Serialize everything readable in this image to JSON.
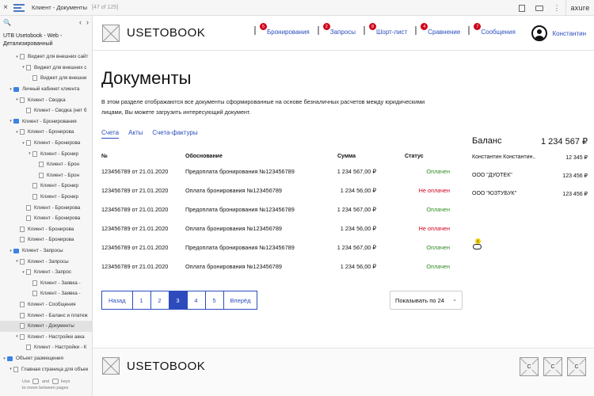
{
  "topbar": {
    "close": "×",
    "title": "Клиент - Документы",
    "count": "[47 of 125]",
    "logo": "axure"
  },
  "sidebar": {
    "search": "🔍",
    "prev": "‹",
    "next": "›",
    "project": "UTB Usetobook - Web - Детализированный",
    "items": [
      {
        "label": "Виджет для внешних сайт",
        "indent": 2,
        "arrow": "▾",
        "kind": "page"
      },
      {
        "label": "Виджет для внешних с",
        "indent": 3,
        "arrow": "▾",
        "kind": "page"
      },
      {
        "label": "Виджет для внешни",
        "indent": 4,
        "arrow": "",
        "kind": "page"
      },
      {
        "label": "Личный кабинет клиента",
        "indent": 1,
        "arrow": "▾",
        "kind": "folder"
      },
      {
        "label": "Клиент - Сводка",
        "indent": 2,
        "arrow": "▾",
        "kind": "page"
      },
      {
        "label": "Клиент - Сводка (нет б",
        "indent": 3,
        "arrow": "",
        "kind": "page"
      },
      {
        "label": "Клиент - Бронирования",
        "indent": 1,
        "arrow": "▾",
        "kind": "folder"
      },
      {
        "label": "Клиент - Бронирова",
        "indent": 2,
        "arrow": "▾",
        "kind": "page"
      },
      {
        "label": "Клиент - Бронирова",
        "indent": 3,
        "arrow": "▾",
        "kind": "page"
      },
      {
        "label": "Клиент - Бронир",
        "indent": 4,
        "arrow": "▾",
        "kind": "page"
      },
      {
        "label": "Клиент - Брон",
        "indent": 5,
        "arrow": "",
        "kind": "page"
      },
      {
        "label": "Клиент - Брон",
        "indent": 5,
        "arrow": "",
        "kind": "page"
      },
      {
        "label": "Клиент - Бронир",
        "indent": 4,
        "arrow": "",
        "kind": "page"
      },
      {
        "label": "Клиент - Бронир",
        "indent": 4,
        "arrow": "",
        "kind": "page"
      },
      {
        "label": "Клиент - Бронирова",
        "indent": 3,
        "arrow": "",
        "kind": "page"
      },
      {
        "label": "Клиент - Бронирова",
        "indent": 3,
        "arrow": "",
        "kind": "page"
      },
      {
        "label": "Клиент - Бронирова",
        "indent": 2,
        "arrow": "",
        "kind": "page"
      },
      {
        "label": "Клиент - Бронирова",
        "indent": 2,
        "arrow": "",
        "kind": "page"
      },
      {
        "label": "Клиент - Запросы",
        "indent": 1,
        "arrow": "▾",
        "kind": "folder"
      },
      {
        "label": "Клиент - Запросы",
        "indent": 2,
        "arrow": "▾",
        "kind": "page"
      },
      {
        "label": "Клиент - Запрос",
        "indent": 3,
        "arrow": "▾",
        "kind": "page"
      },
      {
        "label": "Клиент - Заявка -",
        "indent": 4,
        "arrow": "",
        "kind": "page"
      },
      {
        "label": "Клиент - Заявка -",
        "indent": 4,
        "arrow": "",
        "kind": "page"
      },
      {
        "label": "Клиент - Сообщения",
        "indent": 2,
        "arrow": "",
        "kind": "page"
      },
      {
        "label": "Клиент - Баланс и платеж",
        "indent": 2,
        "arrow": "",
        "kind": "page"
      },
      {
        "label": "Клиент - Документы",
        "indent": 2,
        "arrow": "",
        "kind": "page",
        "selected": true
      },
      {
        "label": "Клиент - Настройки акка",
        "indent": 2,
        "arrow": "▾",
        "kind": "page"
      },
      {
        "label": "Клиент - Настройки - К",
        "indent": 3,
        "arrow": "",
        "kind": "page"
      },
      {
        "label": "Объект размещения",
        "indent": 0,
        "arrow": "▾",
        "kind": "folder"
      },
      {
        "label": "Главная страница для объек",
        "indent": 1,
        "arrow": "▾",
        "kind": "page"
      }
    ],
    "footer_use": "Use",
    "footer_and": "and",
    "footer_keys": "keys",
    "footer_hint": "to move between pages"
  },
  "header": {
    "logo": "USETOBOOK",
    "nav": [
      {
        "label": "Бронирования",
        "badge": "5"
      },
      {
        "label": "Запросы",
        "badge": "2"
      },
      {
        "label": "Шорт-лист",
        "badge": "8"
      },
      {
        "label": "Сравнение",
        "badge": "4"
      },
      {
        "label": "Сообщения",
        "badge": "7"
      }
    ],
    "user": "Константин"
  },
  "main": {
    "title": "Документы",
    "intro": "В этом разделе отображаются все документы сформированные на основе безналичных расчетов между юридическими лицами, Вы можете загрузить интересующий документ.",
    "tabs": [
      "Счета",
      "Акты",
      "Счета-фактуры"
    ],
    "table": {
      "headers": [
        "№",
        "Обоснование",
        "Сумма",
        "Статус"
      ],
      "rows": [
        [
          "123456789 от 21.01.2020",
          "Предоплата бронирования №123456789",
          "1 234 567,00 ₽",
          "Оплачен",
          "ok"
        ],
        [
          "123456789 от 21.01.2020",
          "Оплата бронирования №123456789",
          "1 234 56,00 ₽",
          "Не оплачен",
          "bad"
        ],
        [
          "123456789 от 21.01.2020",
          "Предоплата бронирования №123456789",
          "1 234 567,00 ₽",
          "Оплачен",
          "ok"
        ],
        [
          "123456789 от 21.01.2020",
          "Оплата бронирования №123456789",
          "1 234 56,00 ₽",
          "Не оплачен",
          "bad"
        ],
        [
          "123456789 от 21.01.2020",
          "Предоплата бронирования №123456789",
          "1 234 567,00 ₽",
          "Оплачен",
          "ok"
        ],
        [
          "123456789 от 21.01.2020",
          "Оплата бронирования №123456789",
          "1 234 56,00 ₽",
          "Оплачен",
          "ok"
        ]
      ]
    },
    "pager": [
      "Назад",
      "1",
      "2",
      "3",
      "4",
      "5",
      "Вперёд"
    ],
    "pager_current": "3",
    "per_page": "Показывать по 24",
    "balance": {
      "label": "Баланс",
      "amount": "1 234 567 ₽",
      "rows": [
        {
          "name": "Константин Константин..",
          "value": "12 345 ₽"
        },
        {
          "name": "ООО \"ДУОТЕК\"",
          "value": "123 456 ₽"
        },
        {
          "name": "ООО \"ЮЗТУБУК\"",
          "value": "123 456 ₽"
        }
      ]
    },
    "note_badge": "1"
  },
  "footer": {
    "logo": "USETOBOOK",
    "social": [
      "C",
      "C",
      "C"
    ]
  },
  "colors": {
    "link": "#2b4dbd",
    "ok": "#2e8b22",
    "bad": "#d0021b",
    "badge": "#d0021b",
    "folder": "#3b82e6"
  }
}
